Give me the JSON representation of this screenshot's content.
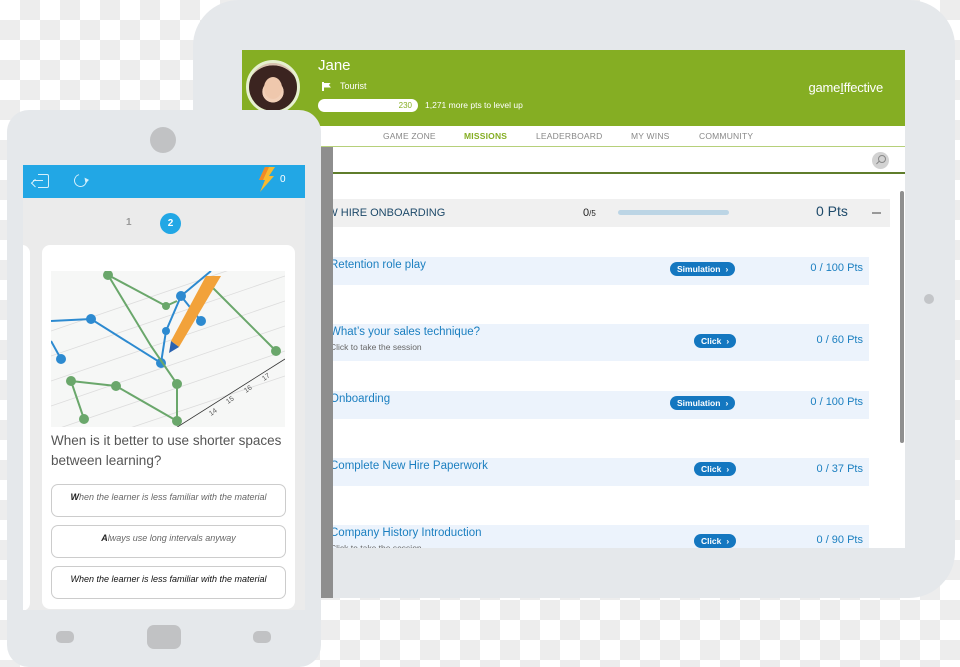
{
  "tablet": {
    "header": {
      "user_name": "Jane",
      "rank": "Tourist",
      "points": "230",
      "level_up_text": "1,271 more pts to level up",
      "logo": "game̲Effective",
      "brand_color": "#85ae23"
    },
    "nav": {
      "items": [
        {
          "label": "GAME ZONE",
          "active": false
        },
        {
          "label": "MISSIONS",
          "active": true
        },
        {
          "label": "LEADERBOARD",
          "active": false
        },
        {
          "label": "MY WINS",
          "active": false
        },
        {
          "label": "COMMUNITY",
          "active": false
        }
      ]
    },
    "section": {
      "title": "EW HIRE ONBOARDING",
      "completed": "0",
      "total": "/5",
      "progress": 0,
      "points": "0  Pts",
      "collapse_icon": "minus-icon"
    },
    "missions": [
      {
        "title": "Retention role play",
        "subtitle": "",
        "button": "Simulation",
        "points": "0  / 100 Pts"
      },
      {
        "title": "What’s your sales technique?",
        "subtitle": "Click to take the session",
        "button": "Click",
        "points": "0  / 60 Pts"
      },
      {
        "title": "Onboarding",
        "subtitle": "",
        "button": "Simulation",
        "points": "0  / 100 Pts"
      },
      {
        "title": "Complete New Hire Paperwork",
        "subtitle": "",
        "button": "Click",
        "points": "0  / 37 Pts"
      },
      {
        "title": "Company History Introduction",
        "subtitle": "Click to take the session",
        "button": "Click",
        "points": "0  / 90 Pts"
      }
    ]
  },
  "phone": {
    "topbar": {
      "exit_icon": "exit-icon",
      "refresh_icon": "refresh-icon",
      "energy_icon": "lightning-bolt-icon",
      "energy_count": "0",
      "accent_color": "#22a7e5"
    },
    "pages": [
      {
        "label": "1",
        "active": false
      },
      {
        "label": "2",
        "active": true
      }
    ],
    "card": {
      "image_alt": "line chart with pencil",
      "image_axis_labels": [
        "14",
        "15",
        "16",
        "17"
      ],
      "question": "When is it better to use shorter spaces between learning?",
      "answers": [
        {
          "first": "W",
          "rest": "hen the learner is less familiar with the material",
          "selected": false
        },
        {
          "first": "A",
          "rest": "lways use long intervals anyway",
          "selected": false
        },
        {
          "first": "",
          "rest": "When the learner is less familiar with the material",
          "selected": true
        }
      ]
    }
  }
}
